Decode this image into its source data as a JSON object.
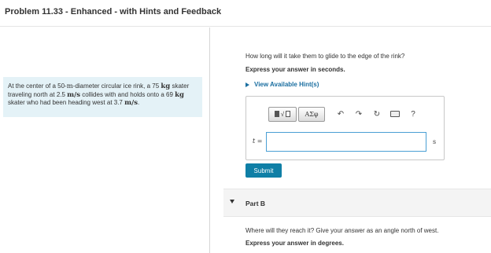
{
  "header": {
    "title": "Problem 11.33 - Enhanced - with Hints and Feedback"
  },
  "problem": {
    "text_1": "At the center of a 50-",
    "unit_m": "m",
    "text_2": "-diameter circular ice rink, a 75 ",
    "unit_kg": "kg",
    "text_3": " skater traveling north at 2.5 ",
    "unit_ms": "m/s",
    "text_4": " collides with and holds onto a 69 ",
    "unit_kg2": "kg",
    "text_5": " skater who had been heading west at 3.7 ",
    "unit_ms2": "m/s",
    "text_6": "."
  },
  "part_a": {
    "question": "How long will it take them to glide to the edge of the rink?",
    "instruction": "Express your answer in seconds.",
    "hints_link": "View Available Hint(s)",
    "toolbar": {
      "templates_icon": "templates-radical-icon",
      "greek_label": "ΑΣφ",
      "undo_icon": "↶",
      "redo_icon": "↷",
      "reset_icon": "↻",
      "keyboard_icon": "keyboard-icon",
      "help_label": "?"
    },
    "variable_label": "t =",
    "answer_value": "",
    "unit": "s",
    "submit_label": "Submit"
  },
  "part_b": {
    "label": "Part B",
    "question": "Where will they reach it? Give your answer as an angle north of west.",
    "instruction": "Express your answer in degrees."
  },
  "colors": {
    "accent": "#0f7fa6",
    "link": "#1a6ea0",
    "problem_bg": "#e4f2f7",
    "input_border": "#4a9fd4"
  }
}
